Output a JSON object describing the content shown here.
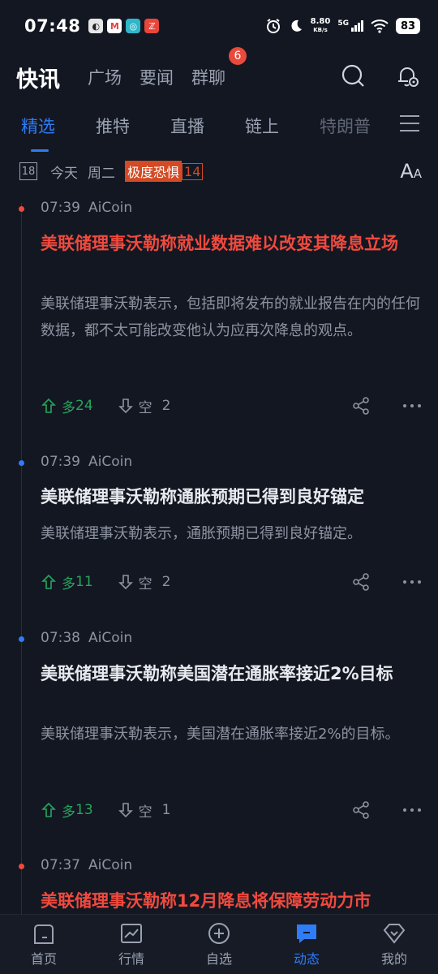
{
  "status": {
    "time": "07:48",
    "net_speed": "8.80",
    "net_unit": "KB/s",
    "signal": "5G",
    "battery": "83"
  },
  "header": {
    "title": "快讯",
    "tabs": [
      {
        "label": "广场"
      },
      {
        "label": "要闻"
      },
      {
        "label": "群聊",
        "badge": "6"
      }
    ]
  },
  "subtabs": [
    {
      "label": "精选",
      "active": true
    },
    {
      "label": "推特"
    },
    {
      "label": "直播"
    },
    {
      "label": "链上"
    },
    {
      "label": "特朗普"
    }
  ],
  "date_row": {
    "calendar_day": "18",
    "today": "今天",
    "weekday": "周二",
    "fear_label": "极度恐惧",
    "fear_value": "14",
    "font_icon": "A",
    "font_icon_small": "A"
  },
  "news": [
    {
      "time": "07:39",
      "source": "AiCoin",
      "title": "美联储理事沃勒称就业数据难以改变其降息立场",
      "summary": "美联储理事沃勒表示，包括即将发布的就业报告在内的任何数据，都不太可能改变他认为应再次降息的观点。",
      "bull_label": "多",
      "bull_count": "24",
      "bear_label": "空",
      "bear_count": "2",
      "highlight": true
    },
    {
      "time": "07:39",
      "source": "AiCoin",
      "title": "美联储理事沃勒称通胀预期已得到良好锚定",
      "summary": "美联储理事沃勒表示，通胀预期已得到良好锚定。",
      "bull_label": "多",
      "bull_count": "11",
      "bear_label": "空",
      "bear_count": "2",
      "highlight": false
    },
    {
      "time": "07:38",
      "source": "AiCoin",
      "title": "美联储理事沃勒称美国潜在通胀率接近2%目标",
      "summary": "美联储理事沃勒表示，美国潜在通胀率接近2%的目标。",
      "bull_label": "多",
      "bull_count": "13",
      "bear_label": "空",
      "bear_count": "1",
      "highlight": false
    },
    {
      "time": "07:37",
      "source": "AiCoin",
      "title": "美联储理事沃勒称12月降息将保障劳动力市",
      "highlight": true
    }
  ],
  "bottom_nav": [
    {
      "label": "首页"
    },
    {
      "label": "行情"
    },
    {
      "label": "自选"
    },
    {
      "label": "动态",
      "active": true
    },
    {
      "label": "我的"
    }
  ],
  "colors": {
    "background": "#131722",
    "accent": "#2f7cf6",
    "bull": "#25a65c",
    "highlight_red": "#f04a3e",
    "fear_badge": "#d34a24"
  }
}
